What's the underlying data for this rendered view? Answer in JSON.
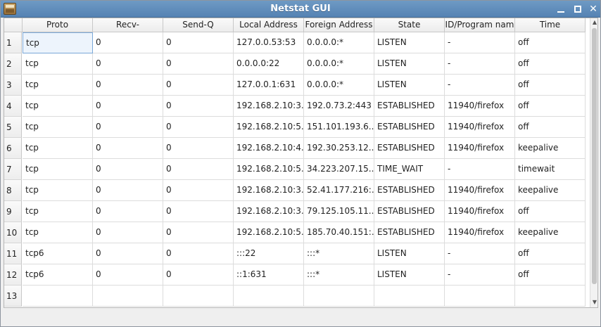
{
  "window": {
    "title": "Netstat GUI"
  },
  "table": {
    "columns": [
      "Proto",
      "Recv-",
      "Send-Q",
      "Local Address",
      "Foreign Address",
      "State",
      "ID/Program nam",
      "Time"
    ],
    "rows": [
      {
        "n": "1",
        "cells": [
          "tcp",
          "0",
          "0",
          "127.0.0.53:53",
          "0.0.0.0:*",
          "LISTEN",
          "-",
          "off"
        ]
      },
      {
        "n": "2",
        "cells": [
          "tcp",
          "0",
          "0",
          "0.0.0.0:22",
          "0.0.0.0:*",
          "LISTEN",
          "-",
          "off"
        ]
      },
      {
        "n": "3",
        "cells": [
          "tcp",
          "0",
          "0",
          "127.0.0.1:631",
          "0.0.0.0:*",
          "LISTEN",
          "-",
          "off"
        ]
      },
      {
        "n": "4",
        "cells": [
          "tcp",
          "0",
          "0",
          "192.168.2.10:3...",
          "192.0.73.2:443",
          "ESTABLISHED",
          "11940/firefox",
          "off"
        ]
      },
      {
        "n": "5",
        "cells": [
          "tcp",
          "0",
          "0",
          "192.168.2.10:5...",
          "151.101.193.6...",
          "ESTABLISHED",
          "11940/firefox",
          "off"
        ]
      },
      {
        "n": "6",
        "cells": [
          "tcp",
          "0",
          "0",
          "192.168.2.10:4...",
          "192.30.253.12...",
          "ESTABLISHED",
          "11940/firefox",
          "keepalive"
        ]
      },
      {
        "n": "7",
        "cells": [
          "tcp",
          "0",
          "0",
          "192.168.2.10:5...",
          "34.223.207.15...",
          "TIME_WAIT",
          "-",
          "timewait"
        ]
      },
      {
        "n": "8",
        "cells": [
          "tcp",
          "0",
          "0",
          "192.168.2.10:3...",
          "52.41.177.216:...",
          "ESTABLISHED",
          "11940/firefox",
          "keepalive"
        ]
      },
      {
        "n": "9",
        "cells": [
          "tcp",
          "0",
          "0",
          "192.168.2.10:3...",
          "79.125.105.11...",
          "ESTABLISHED",
          "11940/firefox",
          "off"
        ]
      },
      {
        "n": "10",
        "cells": [
          "tcp",
          "0",
          "0",
          "192.168.2.10:5...",
          "185.70.40.151:...",
          "ESTABLISHED",
          "11940/firefox",
          "keepalive"
        ]
      },
      {
        "n": "11",
        "cells": [
          "tcp6",
          "0",
          "0",
          ":::22",
          ":::*",
          "LISTEN",
          "-",
          "off"
        ]
      },
      {
        "n": "12",
        "cells": [
          "tcp6",
          "0",
          "0",
          "::1:631",
          ":::*",
          "LISTEN",
          "-",
          "off"
        ]
      },
      {
        "n": "13",
        "cells": [
          "",
          "",
          "",
          "",
          "",
          "",
          "",
          ""
        ]
      }
    ]
  },
  "icons": {
    "app": "app-icon",
    "minimize": "minimize-icon",
    "maximize": "maximize-icon",
    "close": "close-icon",
    "scroll_up": "arrow-up-icon",
    "scroll_down": "arrow-down-icon"
  },
  "colors": {
    "titlebar": "#5f8dbf",
    "selection": "#edf4fc"
  }
}
